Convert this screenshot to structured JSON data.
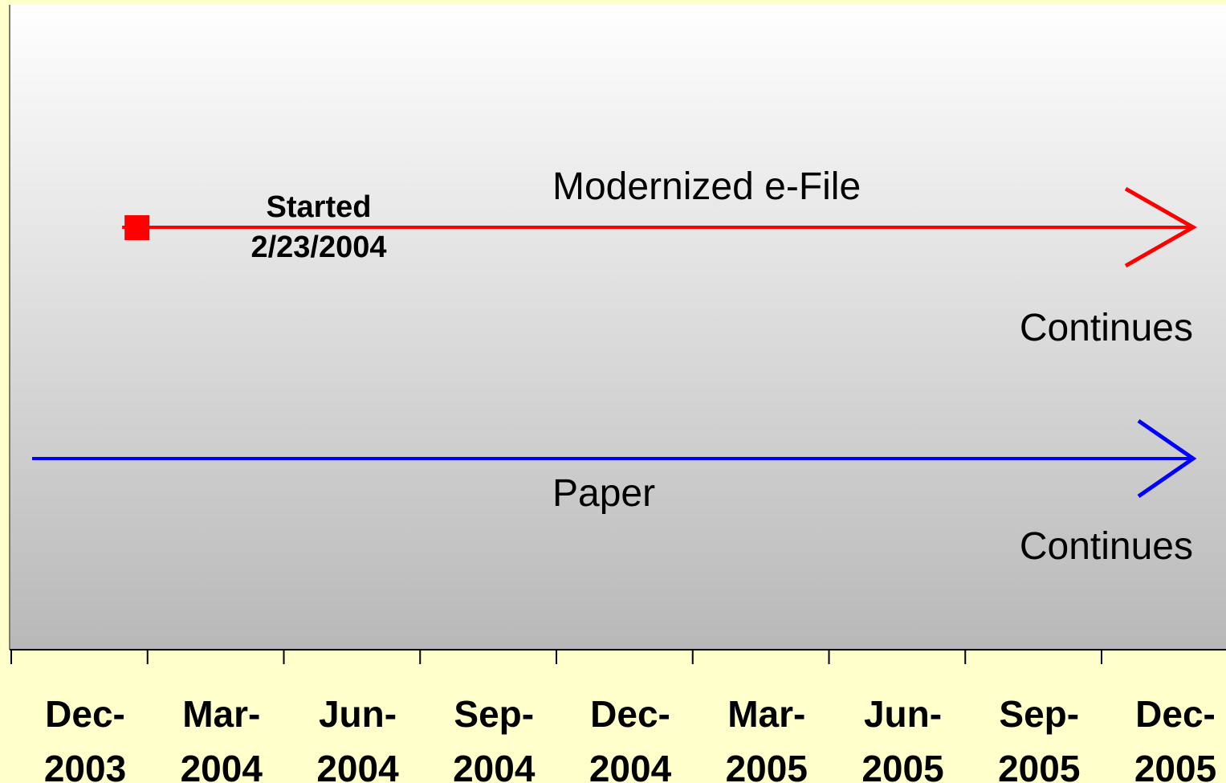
{
  "chart_data": {
    "type": "line",
    "title": "",
    "xlabel": "",
    "ylabel": "",
    "x_ticks": [
      "Dec-2003",
      "Mar-2004",
      "Jun-2004",
      "Sep-2004",
      "Dec-2004",
      "Mar-2005",
      "Jun-2005",
      "Sep-2005",
      "Dec-2005"
    ],
    "x_tick_lines": [
      [
        "Dec-",
        "2003"
      ],
      [
        "Mar-",
        "2004"
      ],
      [
        "Jun-",
        "2004"
      ],
      [
        "Sep-",
        "2004"
      ],
      [
        "Dec-",
        "2004"
      ],
      [
        "Mar-",
        "2005"
      ],
      [
        "Jun-",
        "2005"
      ],
      [
        "Sep-",
        "2005"
      ],
      [
        "Dec-",
        "2005"
      ]
    ],
    "xlim": [
      "2003-12-01",
      "2005-12-31"
    ],
    "grid": false,
    "legend": "none",
    "series": [
      {
        "name": "Modernized e-File",
        "color": "#ff0000",
        "start": "2004-02-23",
        "continues_label": "Continues",
        "marker": {
          "date": "2004-02-23",
          "label_lines": [
            "Started",
            "2/23/2004"
          ]
        }
      },
      {
        "name": "Paper",
        "color": "#0000ff",
        "start": "2003-12-15",
        "continues_label": "Continues"
      }
    ],
    "colors": {
      "page_background": "#ffffcc",
      "plot_gradient_top": "#ffffff",
      "plot_gradient_bottom": "#b8b8b8"
    }
  }
}
